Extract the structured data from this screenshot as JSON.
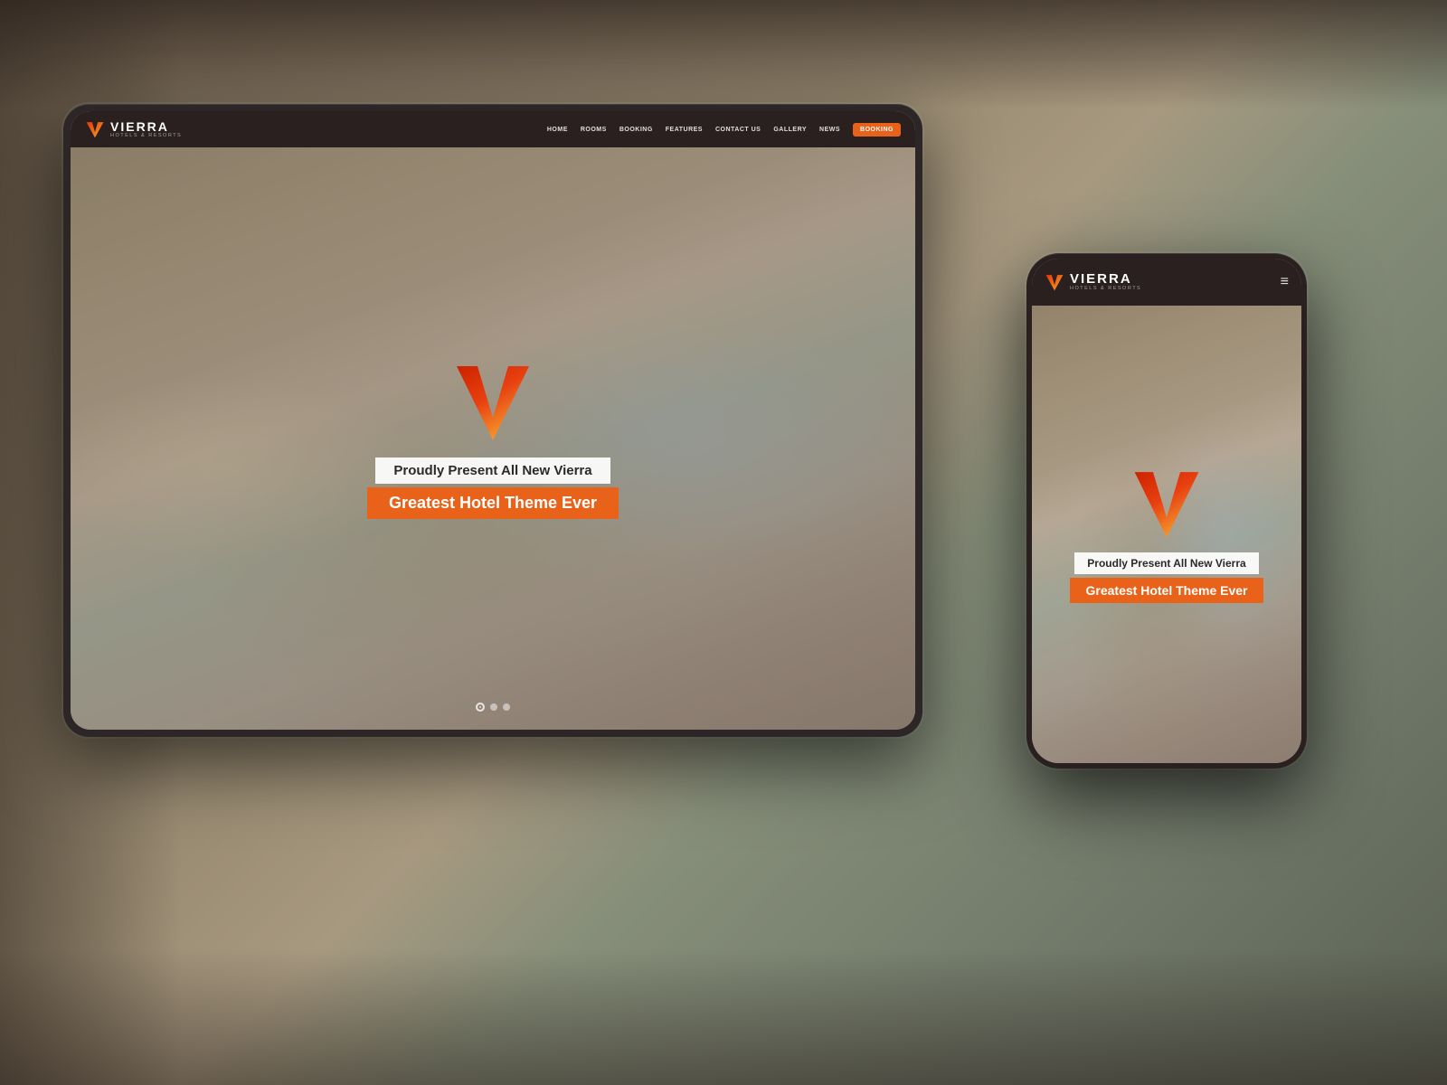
{
  "page": {
    "background_color": "#5a5047"
  },
  "brand": {
    "name": "VIERRA",
    "subtitle": "HOTELS & RESORTS"
  },
  "nav": {
    "links": [
      "HOME",
      "ROOMS",
      "BOOKING",
      "FEATURES",
      "CONTACT US",
      "GALLERY",
      "NEWS"
    ],
    "cta_button": "BOOKING",
    "hamburger_icon": "≡"
  },
  "hero": {
    "pre_title": "Proudly Present All New Vierra",
    "title": "Greatest Hotel Theme Ever",
    "dots": [
      "active",
      "inactive",
      "inactive"
    ]
  },
  "tablet": {
    "label": "tablet-device"
  },
  "mobile": {
    "label": "mobile-device"
  },
  "accent_color": "#e8621a"
}
